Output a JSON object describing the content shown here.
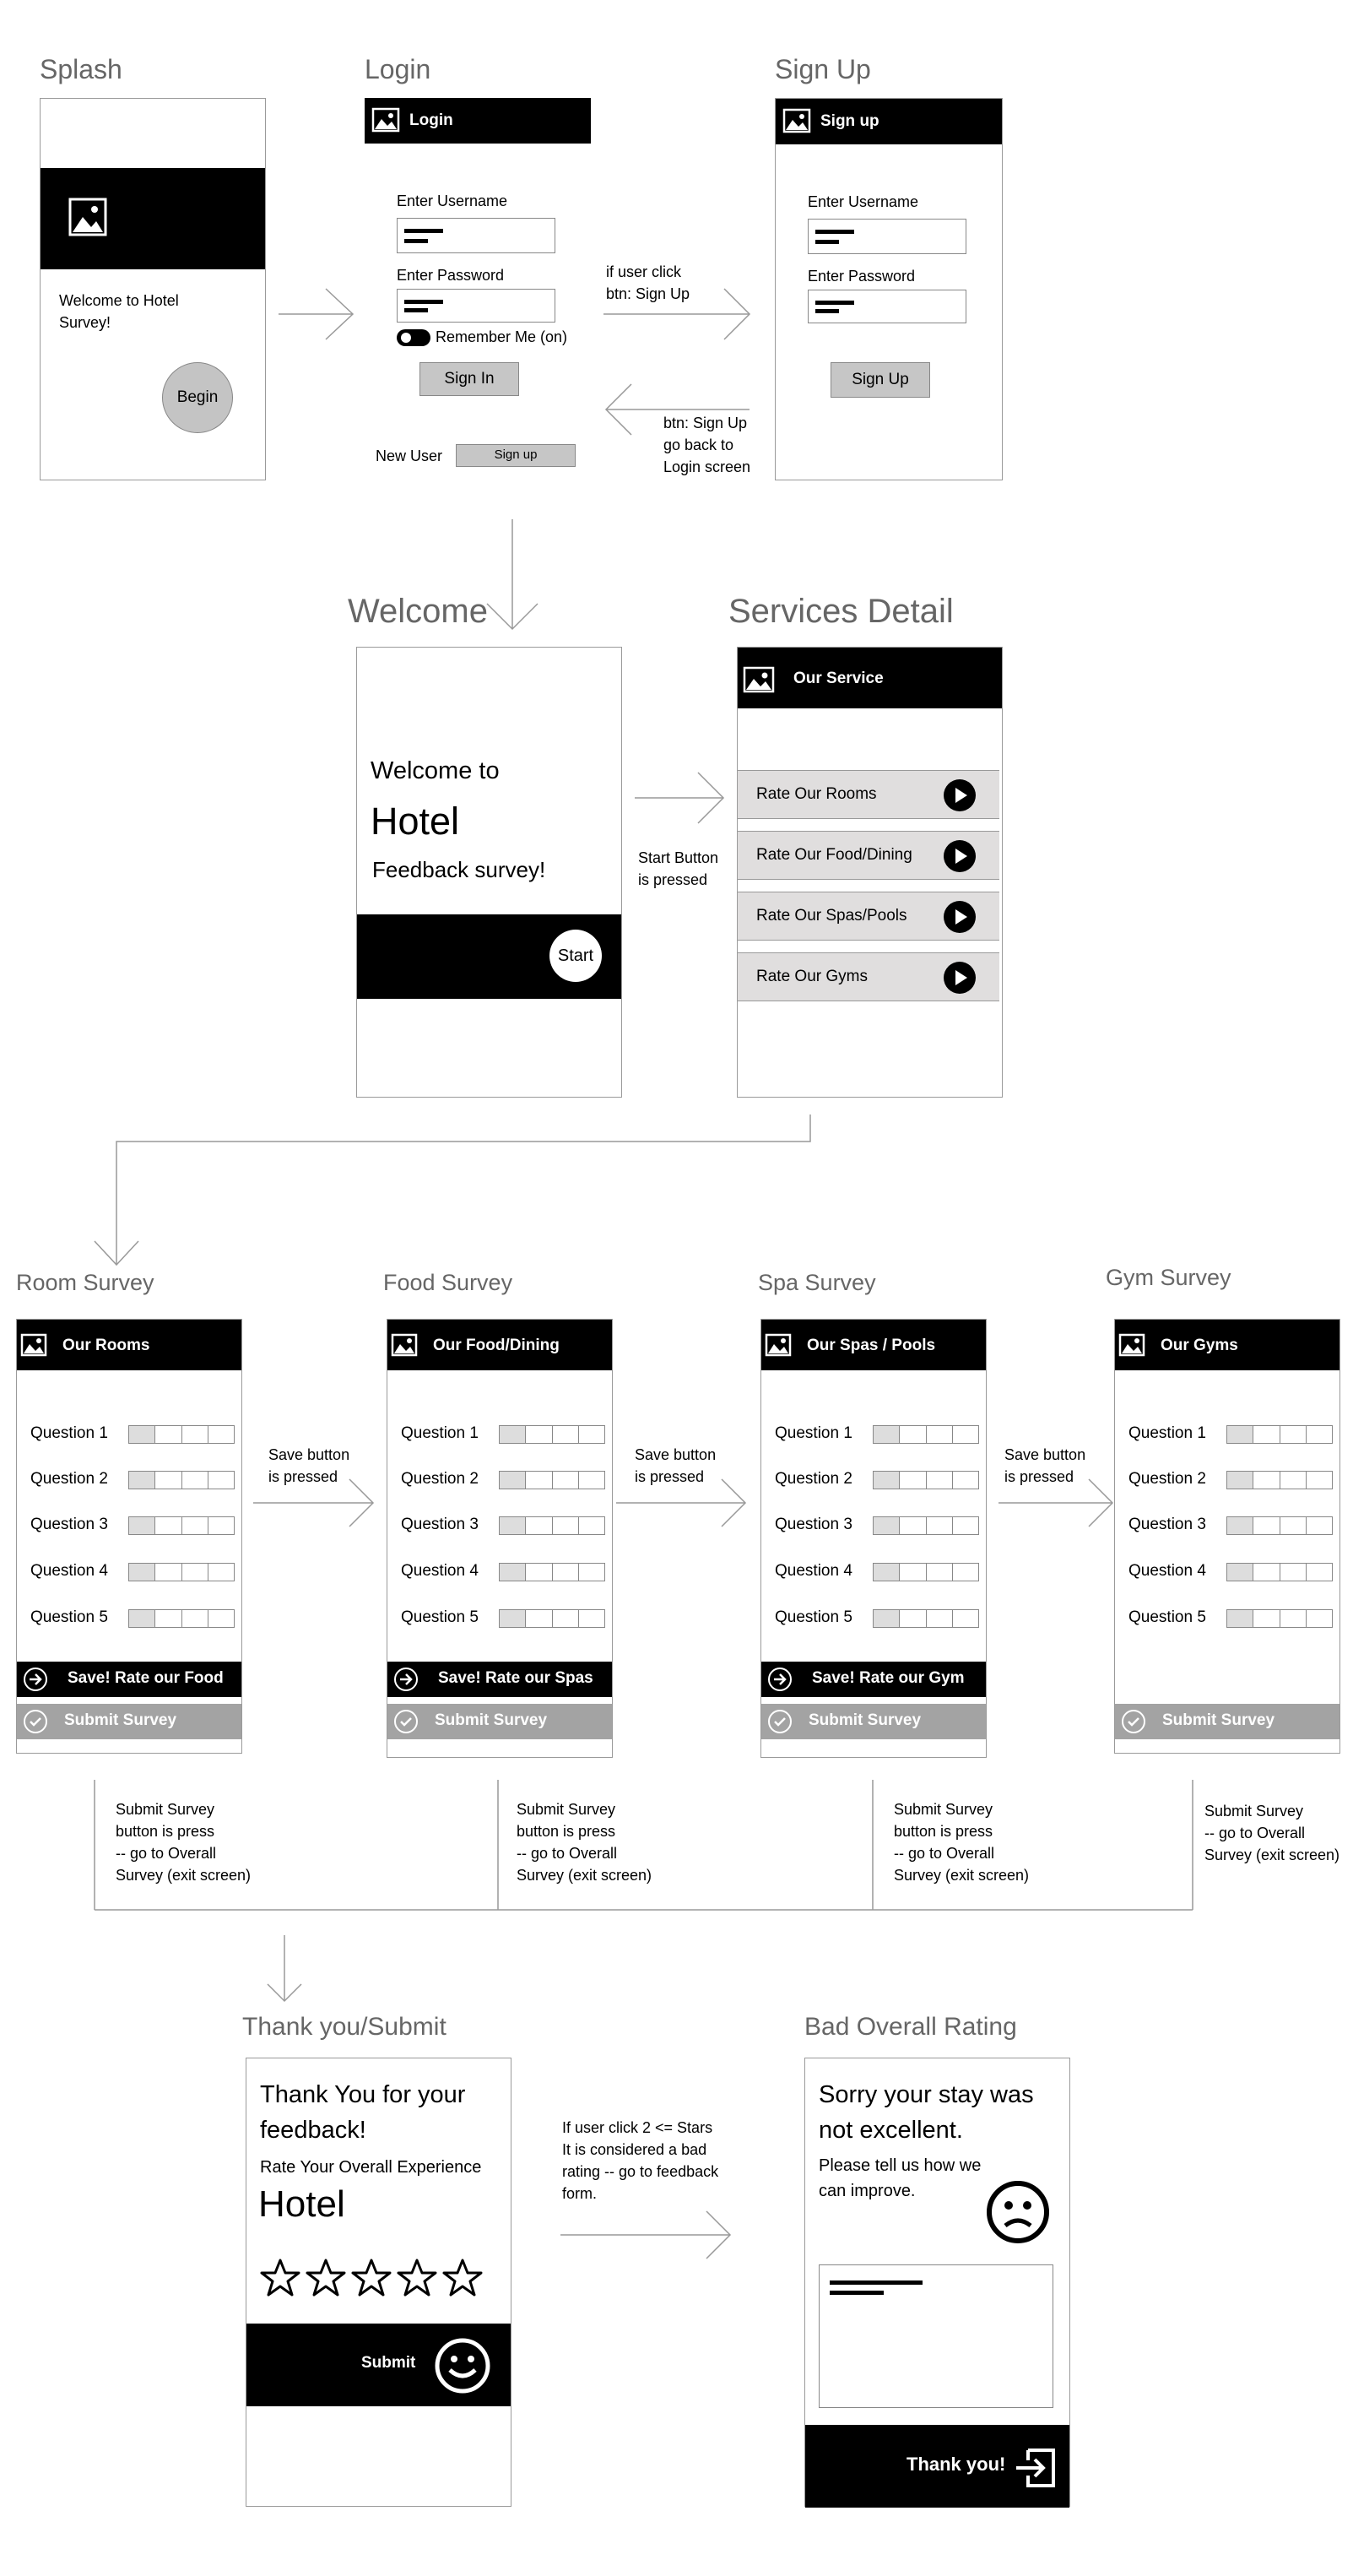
{
  "colors": {
    "bar": "#000000",
    "button_gray": "#c6c6c6",
    "service_row": "#e0dede",
    "submit_bar": "#a3a3a3",
    "frame_border": "#9a9a9a",
    "title_gray": "#666666"
  },
  "splash": {
    "title": "Splash",
    "welcome_text": "Welcome to Hotel\nSurvey!",
    "begin_button": "Begin"
  },
  "login": {
    "title": "Login",
    "bar_label": "Login",
    "username_label": "Enter Username",
    "password_label": "Enter Password",
    "remember_label": "Remember Me (on)",
    "signin_button": "Sign In",
    "new_user_label": "New User",
    "signup_button": "Sign up"
  },
  "signup": {
    "title": "Sign Up",
    "bar_label": "Sign up",
    "username_label": "Enter Username",
    "password_label": "Enter Password",
    "signup_button": "Sign Up"
  },
  "annotations": {
    "to_signup": "if user click\nbtn: Sign Up",
    "back_login": "btn: Sign Up\ngo back to\nLogin screen",
    "start_pressed": "Start Button\nis pressed",
    "save_pressed": "Save button\nis pressed",
    "submit_press": "Submit Survey\nbutton is press\n-- go to Overall\nSurvey (exit screen)",
    "submit_gym": "Submit Survey\n-- go to Overall\nSurvey (exit screen)",
    "bad_rating": "If user click 2 <= Stars\nIt is considered a bad\nrating -- go to feedback\nform."
  },
  "welcome": {
    "title": "Welcome",
    "line1": "Welcome to",
    "line2": "Hotel",
    "line3": "Feedback survey!",
    "start_button": "Start"
  },
  "services": {
    "title": "Services Detail",
    "bar_label": "Our Service",
    "items": [
      "Rate Our Rooms",
      "Rate Our Food/Dining",
      "Rate Our Spas/Pools",
      "Rate Our Gyms"
    ]
  },
  "surveys": [
    {
      "title": "Room Survey",
      "bar_label": "Our Rooms",
      "save_label": "Save!  Rate our Food",
      "submit_label": "Submit Survey"
    },
    {
      "title": "Food Survey",
      "bar_label": "Our Food/Dining",
      "save_label": "Save!  Rate our Spas",
      "submit_label": "Submit Survey"
    },
    {
      "title": "Spa Survey",
      "bar_label": "Our Spas / Pools",
      "save_label": "Save!  Rate our Gym",
      "submit_label": "Submit Survey"
    },
    {
      "title": "Gym Survey",
      "bar_label": "Our Gyms",
      "submit_label": "Submit Survey"
    }
  ],
  "questions": [
    "Question 1",
    "Question 2",
    "Question 3",
    "Question 4",
    "Question 5"
  ],
  "thankyou": {
    "title": "Thank you/Submit",
    "heading": "Thank You for your\nfeedback!",
    "subheading": "Rate Your Overall Experience",
    "hotel": "Hotel",
    "stars": 5,
    "submit_label": "Submit"
  },
  "bad_rating": {
    "title": "Bad Overall Rating",
    "heading": "Sorry your stay was\nnot excellent.",
    "subtext": "Please tell us how we\ncan improve.",
    "thanks_label": "Thank you!"
  }
}
